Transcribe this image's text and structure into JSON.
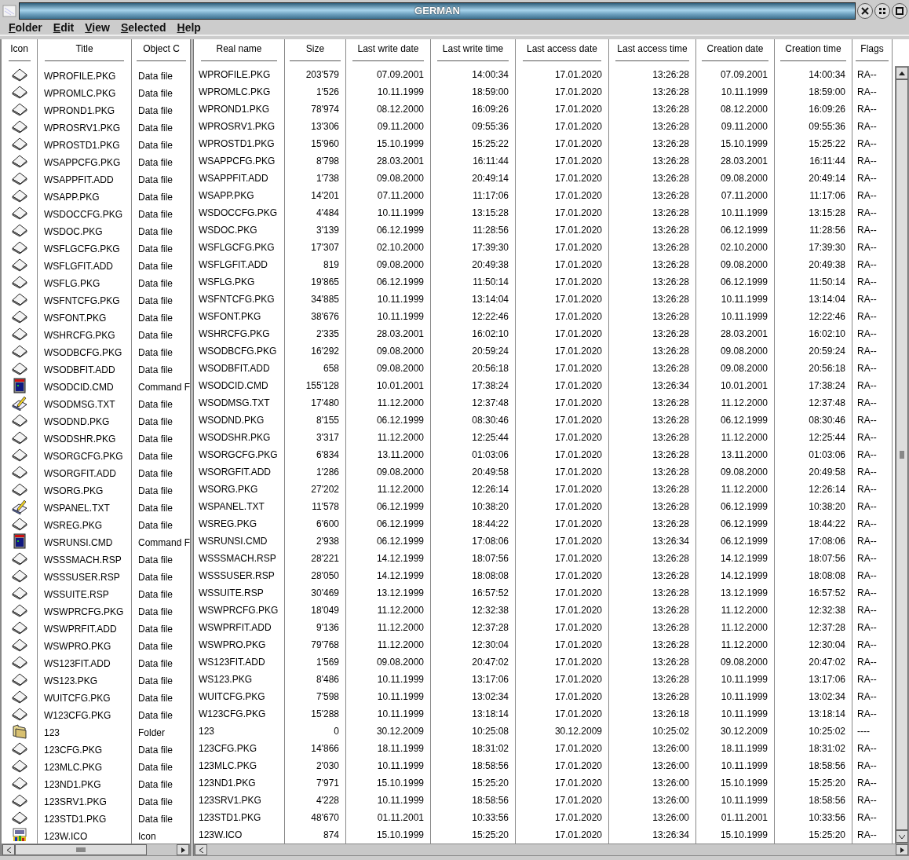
{
  "window": {
    "title": "GERMAN"
  },
  "menu": [
    "Folder",
    "Edit",
    "View",
    "Selected",
    "Help"
  ],
  "left_columns": [
    "Icon",
    "Title",
    "Object C"
  ],
  "right_columns": [
    "Real name",
    "Size",
    "Last write date",
    "Last write time",
    "Last access date",
    "Last access time",
    "Creation date",
    "Creation time",
    "Flags"
  ],
  "rows": [
    {
      "kind": "data",
      "cells": [
        "WPROFILE.PKG",
        "Data file",
        "WPROFILE.PKG",
        "203'579",
        "07.09.2001",
        "14:00:34",
        "17.01.2020",
        "13:26:28",
        "07.09.2001",
        "14:00:34",
        "RA--"
      ]
    },
    {
      "kind": "data",
      "cells": [
        "WPROMLC.PKG",
        "Data file",
        "WPROMLC.PKG",
        "1'526",
        "10.11.1999",
        "18:59:00",
        "17.01.2020",
        "13:26:28",
        "10.11.1999",
        "18:59:00",
        "RA--"
      ]
    },
    {
      "kind": "data",
      "cells": [
        "WPROND1.PKG",
        "Data file",
        "WPROND1.PKG",
        "78'974",
        "08.12.2000",
        "16:09:26",
        "17.01.2020",
        "13:26:28",
        "08.12.2000",
        "16:09:26",
        "RA--"
      ]
    },
    {
      "kind": "data",
      "cells": [
        "WPROSRV1.PKG",
        "Data file",
        "WPROSRV1.PKG",
        "13'306",
        "09.11.2000",
        "09:55:36",
        "17.01.2020",
        "13:26:28",
        "09.11.2000",
        "09:55:36",
        "RA--"
      ]
    },
    {
      "kind": "data",
      "cells": [
        "WPROSTD1.PKG",
        "Data file",
        "WPROSTD1.PKG",
        "15'960",
        "15.10.1999",
        "15:25:22",
        "17.01.2020",
        "13:26:28",
        "15.10.1999",
        "15:25:22",
        "RA--"
      ]
    },
    {
      "kind": "data",
      "cells": [
        "WSAPPCFG.PKG",
        "Data file",
        "WSAPPCFG.PKG",
        "8'798",
        "28.03.2001",
        "16:11:44",
        "17.01.2020",
        "13:26:28",
        "28.03.2001",
        "16:11:44",
        "RA--"
      ]
    },
    {
      "kind": "data",
      "cells": [
        "WSAPPFIT.ADD",
        "Data file",
        "WSAPPFIT.ADD",
        "1'738",
        "09.08.2000",
        "20:49:14",
        "17.01.2020",
        "13:26:28",
        "09.08.2000",
        "20:49:14",
        "RA--"
      ]
    },
    {
      "kind": "data",
      "cells": [
        "WSAPP.PKG",
        "Data file",
        "WSAPP.PKG",
        "14'201",
        "07.11.2000",
        "11:17:06",
        "17.01.2020",
        "13:26:28",
        "07.11.2000",
        "11:17:06",
        "RA--"
      ]
    },
    {
      "kind": "data",
      "cells": [
        "WSDOCCFG.PKG",
        "Data file",
        "WSDOCCFG.PKG",
        "4'484",
        "10.11.1999",
        "13:15:28",
        "17.01.2020",
        "13:26:28",
        "10.11.1999",
        "13:15:28",
        "RA--"
      ]
    },
    {
      "kind": "data",
      "cells": [
        "WSDOC.PKG",
        "Data file",
        "WSDOC.PKG",
        "3'139",
        "06.12.1999",
        "11:28:56",
        "17.01.2020",
        "13:26:28",
        "06.12.1999",
        "11:28:56",
        "RA--"
      ]
    },
    {
      "kind": "data",
      "cells": [
        "WSFLGCFG.PKG",
        "Data file",
        "WSFLGCFG.PKG",
        "17'307",
        "02.10.2000",
        "17:39:30",
        "17.01.2020",
        "13:26:28",
        "02.10.2000",
        "17:39:30",
        "RA--"
      ]
    },
    {
      "kind": "data",
      "cells": [
        "WSFLGFIT.ADD",
        "Data file",
        "WSFLGFIT.ADD",
        "819",
        "09.08.2000",
        "20:49:38",
        "17.01.2020",
        "13:26:28",
        "09.08.2000",
        "20:49:38",
        "RA--"
      ]
    },
    {
      "kind": "data",
      "cells": [
        "WSFLG.PKG",
        "Data file",
        "WSFLG.PKG",
        "19'865",
        "06.12.1999",
        "11:50:14",
        "17.01.2020",
        "13:26:28",
        "06.12.1999",
        "11:50:14",
        "RA--"
      ]
    },
    {
      "kind": "data",
      "cells": [
        "WSFNTCFG.PKG",
        "Data file",
        "WSFNTCFG.PKG",
        "34'885",
        "10.11.1999",
        "13:14:04",
        "17.01.2020",
        "13:26:28",
        "10.11.1999",
        "13:14:04",
        "RA--"
      ]
    },
    {
      "kind": "data",
      "cells": [
        "WSFONT.PKG",
        "Data file",
        "WSFONT.PKG",
        "38'676",
        "10.11.1999",
        "12:22:46",
        "17.01.2020",
        "13:26:28",
        "10.11.1999",
        "12:22:46",
        "RA--"
      ]
    },
    {
      "kind": "data",
      "cells": [
        "WSHRCFG.PKG",
        "Data file",
        "WSHRCFG.PKG",
        "2'335",
        "28.03.2001",
        "16:02:10",
        "17.01.2020",
        "13:26:28",
        "28.03.2001",
        "16:02:10",
        "RA--"
      ]
    },
    {
      "kind": "data",
      "cells": [
        "WSODBCFG.PKG",
        "Data file",
        "WSODBCFG.PKG",
        "16'292",
        "09.08.2000",
        "20:59:24",
        "17.01.2020",
        "13:26:28",
        "09.08.2000",
        "20:59:24",
        "RA--"
      ]
    },
    {
      "kind": "data",
      "cells": [
        "WSODBFIT.ADD",
        "Data file",
        "WSODBFIT.ADD",
        "658",
        "09.08.2000",
        "20:56:18",
        "17.01.2020",
        "13:26:28",
        "09.08.2000",
        "20:56:18",
        "RA--"
      ]
    },
    {
      "kind": "command",
      "cells": [
        "WSODCID.CMD",
        "Command F",
        "WSODCID.CMD",
        "155'128",
        "10.01.2001",
        "17:38:24",
        "17.01.2020",
        "13:26:34",
        "10.01.2001",
        "17:38:24",
        "RA--"
      ]
    },
    {
      "kind": "text",
      "cells": [
        "WSODMSG.TXT",
        "Data file",
        "WSODMSG.TXT",
        "17'480",
        "11.12.2000",
        "12:37:48",
        "17.01.2020",
        "13:26:28",
        "11.12.2000",
        "12:37:48",
        "RA--"
      ]
    },
    {
      "kind": "data",
      "cells": [
        "WSODND.PKG",
        "Data file",
        "WSODND.PKG",
        "8'155",
        "06.12.1999",
        "08:30:46",
        "17.01.2020",
        "13:26:28",
        "06.12.1999",
        "08:30:46",
        "RA--"
      ]
    },
    {
      "kind": "data",
      "cells": [
        "WSODSHR.PKG",
        "Data file",
        "WSODSHR.PKG",
        "3'317",
        "11.12.2000",
        "12:25:44",
        "17.01.2020",
        "13:26:28",
        "11.12.2000",
        "12:25:44",
        "RA--"
      ]
    },
    {
      "kind": "data",
      "cells": [
        "WSORGCFG.PKG",
        "Data file",
        "WSORGCFG.PKG",
        "6'834",
        "13.11.2000",
        "01:03:06",
        "17.01.2020",
        "13:26:28",
        "13.11.2000",
        "01:03:06",
        "RA--"
      ]
    },
    {
      "kind": "data",
      "cells": [
        "WSORGFIT.ADD",
        "Data file",
        "WSORGFIT.ADD",
        "1'286",
        "09.08.2000",
        "20:49:58",
        "17.01.2020",
        "13:26:28",
        "09.08.2000",
        "20:49:58",
        "RA--"
      ]
    },
    {
      "kind": "data",
      "cells": [
        "WSORG.PKG",
        "Data file",
        "WSORG.PKG",
        "27'202",
        "11.12.2000",
        "12:26:14",
        "17.01.2020",
        "13:26:28",
        "11.12.2000",
        "12:26:14",
        "RA--"
      ]
    },
    {
      "kind": "text",
      "cells": [
        "WSPANEL.TXT",
        "Data file",
        "WSPANEL.TXT",
        "11'578",
        "06.12.1999",
        "10:38:20",
        "17.01.2020",
        "13:26:28",
        "06.12.1999",
        "10:38:20",
        "RA--"
      ]
    },
    {
      "kind": "data",
      "cells": [
        "WSREG.PKG",
        "Data file",
        "WSREG.PKG",
        "6'600",
        "06.12.1999",
        "18:44:22",
        "17.01.2020",
        "13:26:28",
        "06.12.1999",
        "18:44:22",
        "RA--"
      ]
    },
    {
      "kind": "command",
      "cells": [
        "WSRUNSI.CMD",
        "Command F",
        "WSRUNSI.CMD",
        "2'938",
        "06.12.1999",
        "17:08:06",
        "17.01.2020",
        "13:26:34",
        "06.12.1999",
        "17:08:06",
        "RA--"
      ]
    },
    {
      "kind": "data",
      "cells": [
        "WSSSMACH.RSP",
        "Data file",
        "WSSSMACH.RSP",
        "28'221",
        "14.12.1999",
        "18:07:56",
        "17.01.2020",
        "13:26:28",
        "14.12.1999",
        "18:07:56",
        "RA--"
      ]
    },
    {
      "kind": "data",
      "cells": [
        "WSSSUSER.RSP",
        "Data file",
        "WSSSUSER.RSP",
        "28'050",
        "14.12.1999",
        "18:08:08",
        "17.01.2020",
        "13:26:28",
        "14.12.1999",
        "18:08:08",
        "RA--"
      ]
    },
    {
      "kind": "data",
      "cells": [
        "WSSUITE.RSP",
        "Data file",
        "WSSUITE.RSP",
        "30'469",
        "13.12.1999",
        "16:57:52",
        "17.01.2020",
        "13:26:28",
        "13.12.1999",
        "16:57:52",
        "RA--"
      ]
    },
    {
      "kind": "data",
      "cells": [
        "WSWPRCFG.PKG",
        "Data file",
        "WSWPRCFG.PKG",
        "18'049",
        "11.12.2000",
        "12:32:38",
        "17.01.2020",
        "13:26:28",
        "11.12.2000",
        "12:32:38",
        "RA--"
      ]
    },
    {
      "kind": "data",
      "cells": [
        "WSWPRFIT.ADD",
        "Data file",
        "WSWPRFIT.ADD",
        "9'136",
        "11.12.2000",
        "12:37:28",
        "17.01.2020",
        "13:26:28",
        "11.12.2000",
        "12:37:28",
        "RA--"
      ]
    },
    {
      "kind": "data",
      "cells": [
        "WSWPRO.PKG",
        "Data file",
        "WSWPRO.PKG",
        "79'768",
        "11.12.2000",
        "12:30:04",
        "17.01.2020",
        "13:26:28",
        "11.12.2000",
        "12:30:04",
        "RA--"
      ]
    },
    {
      "kind": "data",
      "cells": [
        "WS123FIT.ADD",
        "Data file",
        "WS123FIT.ADD",
        "1'569",
        "09.08.2000",
        "20:47:02",
        "17.01.2020",
        "13:26:28",
        "09.08.2000",
        "20:47:02",
        "RA--"
      ]
    },
    {
      "kind": "data",
      "cells": [
        "WS123.PKG",
        "Data file",
        "WS123.PKG",
        "8'486",
        "10.11.1999",
        "13:17:06",
        "17.01.2020",
        "13:26:28",
        "10.11.1999",
        "13:17:06",
        "RA--"
      ]
    },
    {
      "kind": "data",
      "cells": [
        "WUITCFG.PKG",
        "Data file",
        "WUITCFG.PKG",
        "7'598",
        "10.11.1999",
        "13:02:34",
        "17.01.2020",
        "13:26:28",
        "10.11.1999",
        "13:02:34",
        "RA--"
      ]
    },
    {
      "kind": "data",
      "cells": [
        "W123CFG.PKG",
        "Data file",
        "W123CFG.PKG",
        "15'288",
        "10.11.1999",
        "13:18:14",
        "17.01.2020",
        "13:26:18",
        "10.11.1999",
        "13:18:14",
        "RA--"
      ]
    },
    {
      "kind": "folder",
      "cells": [
        "123",
        "Folder",
        "123",
        "0",
        "30.12.2009",
        "10:25:08",
        "30.12.2009",
        "10:25:02",
        "30.12.2009",
        "10:25:02",
        "----"
      ]
    },
    {
      "kind": "data",
      "cells": [
        "123CFG.PKG",
        "Data file",
        "123CFG.PKG",
        "14'866",
        "18.11.1999",
        "18:31:02",
        "17.01.2020",
        "13:26:00",
        "18.11.1999",
        "18:31:02",
        "RA--"
      ]
    },
    {
      "kind": "data",
      "cells": [
        "123MLC.PKG",
        "Data file",
        "123MLC.PKG",
        "2'030",
        "10.11.1999",
        "18:58:56",
        "17.01.2020",
        "13:26:00",
        "10.11.1999",
        "18:58:56",
        "RA--"
      ]
    },
    {
      "kind": "data",
      "cells": [
        "123ND1.PKG",
        "Data file",
        "123ND1.PKG",
        "7'971",
        "15.10.1999",
        "15:25:20",
        "17.01.2020",
        "13:26:00",
        "15.10.1999",
        "15:25:20",
        "RA--"
      ]
    },
    {
      "kind": "data",
      "cells": [
        "123SRV1.PKG",
        "Data file",
        "123SRV1.PKG",
        "4'228",
        "10.11.1999",
        "18:58:56",
        "17.01.2020",
        "13:26:00",
        "10.11.1999",
        "18:58:56",
        "RA--"
      ]
    },
    {
      "kind": "data",
      "cells": [
        "123STD1.PKG",
        "Data file",
        "123STD1.PKG",
        "48'670",
        "01.11.2001",
        "10:33:56",
        "17.01.2020",
        "13:26:00",
        "01.11.2001",
        "10:33:56",
        "RA--"
      ]
    },
    {
      "kind": "icon",
      "cells": [
        "123W.ICO",
        "Icon",
        "123W.ICO",
        "874",
        "15.10.1999",
        "15:25:20",
        "17.01.2020",
        "13:26:34",
        "15.10.1999",
        "15:25:20",
        "RA--"
      ]
    }
  ]
}
